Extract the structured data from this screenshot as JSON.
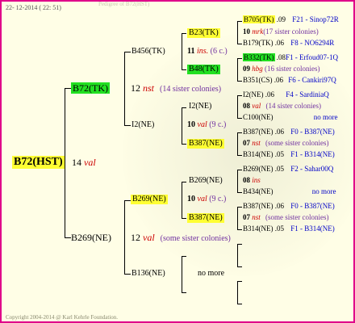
{
  "header": {
    "date": "22- 12-2014 ( 22: 51)",
    "title": "Pedigree of B72(HST)"
  },
  "footer": {
    "copyright": "Copyright 2004-2014 @ Karl Kehrle Foundation."
  },
  "gen1": {
    "label": "B72(HST)",
    "num": "14",
    "type": "val"
  },
  "gen2": [
    {
      "label": "B72(TK)",
      "num": "12",
      "type": "nst",
      "note": "(14 sister colonies)"
    },
    {
      "label": "B269(NE)",
      "num": "12",
      "type": "val",
      "note": "(some sister colonies)"
    }
  ],
  "gen3": [
    {
      "label": "B456(TK)",
      "num": "11",
      "type": "ins.",
      "note": "(6 c.)"
    },
    {
      "label": "I2(NE)",
      "num": "10",
      "type": "val",
      "note": "(9 c.)"
    },
    {
      "label": "B269(NE)",
      "num": "10",
      "type": "val",
      "note": "(9 c.)"
    },
    {
      "label": "B136(NE)",
      "note": "no more"
    }
  ],
  "gen4": [
    {
      "label": "B23(TK)"
    },
    {
      "label": "B48(TK)"
    },
    {
      "label": "I2(NE)"
    },
    {
      "label": "B387(NE)"
    },
    {
      "label": "B269(NE)"
    },
    {
      "label": "B387(NE)"
    }
  ],
  "gen5": [
    {
      "label": "B705(TK)",
      "year": ".09",
      "loc": "F21 - Sinop72R"
    },
    {
      "num": "10",
      "type": "mrk",
      "note": "(17 sister colonies)"
    },
    {
      "label": "B179(TK)",
      "year": ".06",
      "loc": "F8 - NO6294R"
    },
    {
      "label": "B332(TK)",
      "year": ".08",
      "loc": "F1 - Erfoud07-1Q"
    },
    {
      "num": "09",
      "type": "hbg",
      "note": "(16 sister colonies)"
    },
    {
      "label": "B351(CS)",
      "year": ".06",
      "loc": "F6 - Cankiri97Q"
    },
    {
      "label": "I2(NE)",
      "year": ".06",
      "loc": "F4 - SardiniaQ"
    },
    {
      "num": "08",
      "type": "val",
      "note": "(14 sister colonies)"
    },
    {
      "label": "C100(NE)",
      "note": "no more"
    },
    {
      "label": "B387(NE)",
      "year": ".06",
      "loc": "F0 - B387(NE)"
    },
    {
      "num": "07",
      "type": "nst",
      "note": "(some sister colonies)"
    },
    {
      "label": "B314(NE)",
      "year": ".05",
      "loc": "F1 - B314(NE)"
    },
    {
      "label": "B269(NE)",
      "year": ".05",
      "loc": "F2 - Sahar00Q"
    },
    {
      "num": "08",
      "type": "ins"
    },
    {
      "label": "B434(NE)",
      "note": "no more"
    },
    {
      "label": "B387(NE)",
      "year": ".06",
      "loc": "F0 - B387(NE)"
    },
    {
      "num": "07",
      "type": "nst",
      "note": "(some sister colonies)"
    },
    {
      "label": "B314(NE)",
      "year": ".05",
      "loc": "F1 - B314(NE)"
    }
  ]
}
